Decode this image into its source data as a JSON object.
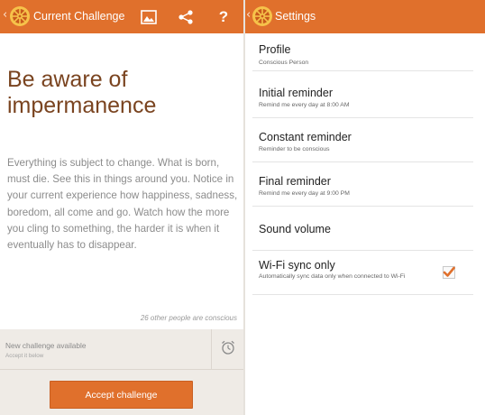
{
  "left": {
    "actionbar": {
      "back_glyph": "‹",
      "title": "Current Challenge",
      "icons": [
        "image-icon",
        "share-icon",
        "help-icon"
      ],
      "help_label": "?"
    },
    "challenge": {
      "title": "Be aware of impermanence",
      "body": "Everything is subject to change. What is born, must die. See this in things around you. Notice in your current experience how happiness, sadness, boredom, all come and go. Watch how the more you cling to something, the harder it is when it eventually has to disappear.",
      "conscious_count": "26 other people are conscious"
    },
    "notice": {
      "title": "New challenge available",
      "subtitle": "Accept it below"
    },
    "accept_label": "Accept challenge"
  },
  "right": {
    "actionbar": {
      "back_glyph": "‹",
      "title": "Settings"
    },
    "settings": [
      {
        "title": "Profile",
        "summary": "Conscious Person"
      },
      {
        "title": "Initial reminder",
        "summary": "Remind me every day at 8:00 AM"
      },
      {
        "title": "Constant reminder",
        "summary": "Reminder to be conscious"
      },
      {
        "title": "Final reminder",
        "summary": "Remind me every day at 9:00 PM"
      },
      {
        "title": "Sound volume",
        "summary": ""
      },
      {
        "title": "Wi-Fi sync only",
        "summary": "Automatically sync data only when connected to Wi-Fi",
        "checked": true
      }
    ]
  },
  "colors": {
    "accent": "#e0702c",
    "title_brown": "#7a4420",
    "checkmark": "#e0702c"
  }
}
